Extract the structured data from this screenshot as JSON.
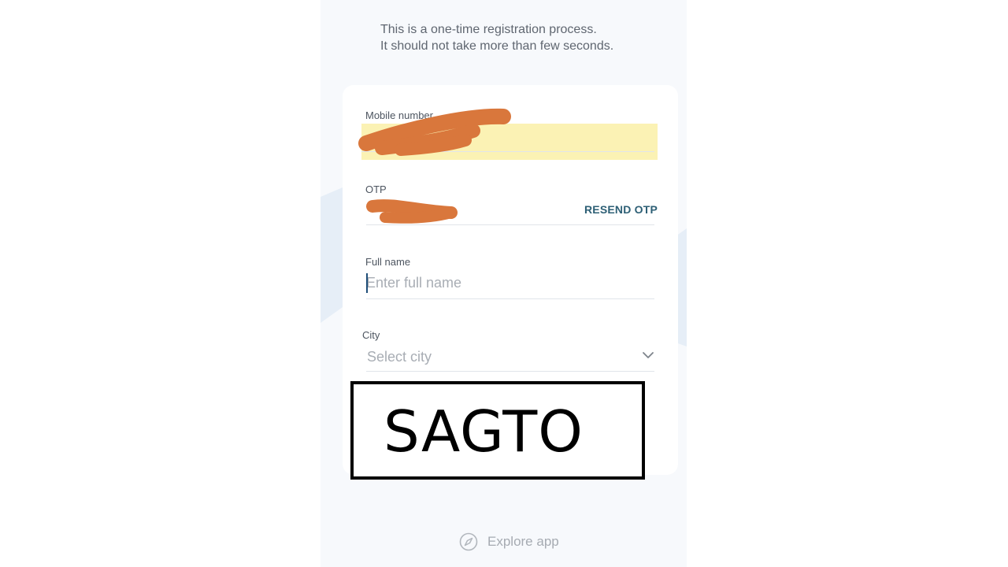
{
  "intro": {
    "line1": "This is a one-time registration process.",
    "line2": "It should not take more than few seconds."
  },
  "form": {
    "mobile": {
      "label": "Mobile number"
    },
    "otp": {
      "label": "OTP",
      "resend_label": "RESEND OTP"
    },
    "full_name": {
      "label": "Full name",
      "placeholder": "Enter full name"
    },
    "city": {
      "label": "City",
      "placeholder": "Select city"
    }
  },
  "watermark": {
    "text": "SAGTO"
  },
  "footer": {
    "explore_label": "Explore app",
    "icon": "compass-icon"
  },
  "colors": {
    "accent": "#2d5f75",
    "autofill_highlight": "#fbf2b4",
    "redaction": "#d9773c",
    "background": "#f7f9fc"
  }
}
